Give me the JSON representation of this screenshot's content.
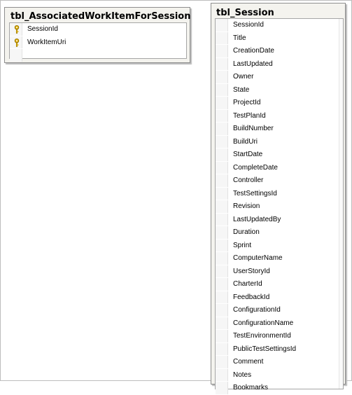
{
  "tables": {
    "associated": {
      "name": "tbl_AssociatedWorkItemForSession",
      "columns": [
        {
          "label": "SessionId",
          "icon": "key-icon"
        },
        {
          "label": "WorkItemUri",
          "icon": "key-icon"
        }
      ]
    },
    "session": {
      "name": "tbl_Session",
      "columns": [
        "SessionId",
        "Title",
        "CreationDate",
        "LastUpdated",
        "Owner",
        "State",
        "ProjectId",
        "TestPlanId",
        "BuildNumber",
        "BuildUri",
        "StartDate",
        "CompleteDate",
        "Controller",
        "TestSettingsId",
        "Revision",
        "LastUpdatedBy",
        "Duration",
        "Sprint",
        "ComputerName",
        "UserStoryId",
        "CharterId",
        "FeedbackId",
        "ConfigurationId",
        "ConfigurationName",
        "TestEnvironmentId",
        "PublicTestSettingsId",
        "Comment",
        "Notes",
        "Bookmarks"
      ]
    }
  },
  "colors": {
    "key_icon": "#e0b000",
    "box_bg": "#f4f3ee"
  }
}
